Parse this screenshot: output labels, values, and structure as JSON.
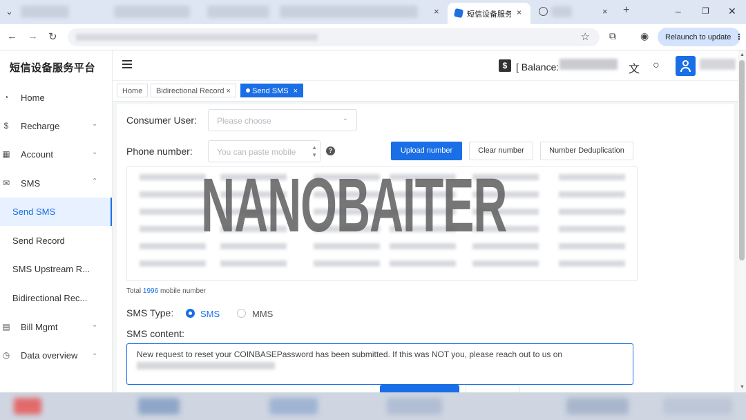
{
  "browser": {
    "active_tab_title": "短信设备服务",
    "relaunch_label": "Relaunch to update"
  },
  "brand": {
    "title": "短信设备服务平台"
  },
  "sidebar": {
    "items": [
      {
        "label": "Home",
        "icon": "gauge-icon"
      },
      {
        "label": "Recharge",
        "icon": "dollar-circle-icon"
      },
      {
        "label": "Account",
        "icon": "building-icon"
      },
      {
        "label": "SMS",
        "icon": "mail-icon"
      },
      {
        "label": "Bill Mgmt",
        "icon": "bill-icon"
      },
      {
        "label": "Data overview",
        "icon": "pie-icon"
      }
    ],
    "sms_submenu": [
      {
        "label": "Send SMS",
        "active": true
      },
      {
        "label": "Send Record"
      },
      {
        "label": "SMS Upstream R..."
      },
      {
        "label": "Bidirectional Rec..."
      }
    ]
  },
  "header": {
    "balance_label": "[ Balance:"
  },
  "tags": [
    {
      "label": "Home"
    },
    {
      "label": "Bidirectional Record"
    },
    {
      "label": "Send SMS",
      "active": true
    }
  ],
  "form": {
    "consumer_user_label": "Consumer User:",
    "consumer_user_placeholder": "Please choose",
    "phone_label": "Phone number:",
    "phone_placeholder": "You can paste mobile",
    "upload_btn": "Upload number",
    "clear_btn": "Clear number",
    "dedup_btn": "Number Deduplication",
    "total_prefix": "Total",
    "total_count": "1996",
    "total_suffix": "mobile number",
    "sms_type_label": "SMS Type:",
    "type_sms": "SMS",
    "type_mms": "MMS",
    "content_label": "SMS content:",
    "content_text": "New request to reset your COINBASEPassword has been submitted. If this was NOT you, please reach out to us on"
  },
  "watermark": "NANOBAITER",
  "colors": {
    "accent": "#1a6ee6"
  }
}
